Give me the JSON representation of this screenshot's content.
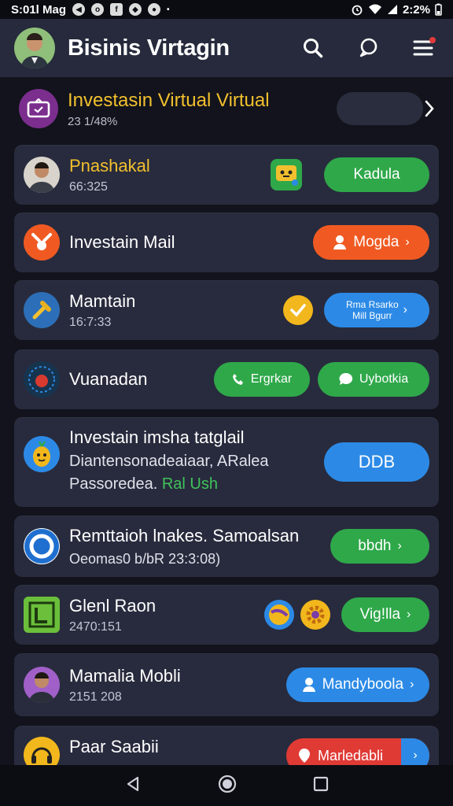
{
  "status_bar": {
    "time": "S:01l Mag",
    "battery": "2:2%"
  },
  "header": {
    "title": "Bisinis Virtagin"
  },
  "featured": {
    "title": "Investasin Virtual Virtual",
    "subtitle": "23 1/48%"
  },
  "cards": [
    {
      "title": "Pnashakal",
      "subtitle": "66:325",
      "button": "Kadula"
    },
    {
      "title": "Investain Mail",
      "button": "Mogda"
    },
    {
      "title": "Mamtain",
      "subtitle": "16:7:33",
      "button_line1": "Rma Rsarko",
      "button_line2": "Mill Bgurr"
    },
    {
      "title": "Vuanadan",
      "button1": "Ergrkar",
      "button2": "Uybotkia"
    },
    {
      "title": "Investain imsha tatglail",
      "line2": "Diantensonadeaiaar, ARalea",
      "line3_prefix": "Passoredea.",
      "line3_green": "Ral Ush",
      "button": "DDB"
    },
    {
      "title": "Remttaioh lnakes. Samoalsan",
      "subtitle": "Oeomas0 b/bR 23:3:08)",
      "button": "bbdh"
    },
    {
      "title": "Glenl Raon",
      "subtitle": "2470:151",
      "button": "Vig!lla"
    },
    {
      "title": "Mamalia Mobli",
      "subtitle": "2151 208",
      "button": "Mandyboola"
    },
    {
      "title": "Paar Saabii",
      "button": "Marledabli"
    }
  ],
  "colors": {
    "accent_yellow": "#f2c02e",
    "green": "#2fa84a",
    "orange": "#f05a22",
    "blue": "#2c8ae6",
    "red": "#e03a35",
    "card_bg": "#282b3d",
    "header_bg": "#262a3c"
  },
  "icons": [
    "avatar",
    "search-icon",
    "chat-icon",
    "menu-icon",
    "tv-icon",
    "chevron-right-icon",
    "back-icon",
    "home-icon",
    "recents-icon"
  ]
}
